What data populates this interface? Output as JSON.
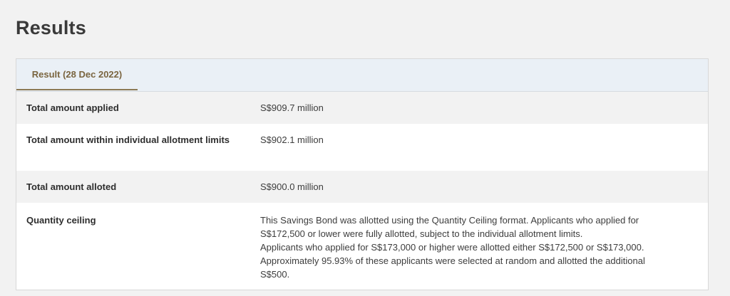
{
  "page": {
    "title": "Results"
  },
  "tabs": [
    {
      "label": "Result (28 Dec 2022)",
      "active": true
    }
  ],
  "rows": [
    {
      "label": "Total amount applied",
      "value": "S$909.7 million"
    },
    {
      "label": "Total amount within individual allotment limits",
      "value": "S$902.1 million"
    },
    {
      "label": "Total amount alloted",
      "value": "S$900.0 million"
    },
    {
      "label": "Quantity ceiling",
      "lines": [
        "This Savings Bond was allotted using the Quantity Ceiling format. Applicants who applied for",
        "S$172,500 or lower were fully allotted, subject to the individual allotment limits.",
        "Applicants who applied for S$173,000 or higher were allotted either S$172,500 or S$173,000.",
        "Approximately 95.93% of these applicants were selected at random and allotted the additional",
        "S$500."
      ]
    }
  ],
  "colors": {
    "tab_accent": "#8c7a55",
    "tab_bar_bg": "#eaf0f6",
    "row_shaded": "#f2f2f2"
  }
}
